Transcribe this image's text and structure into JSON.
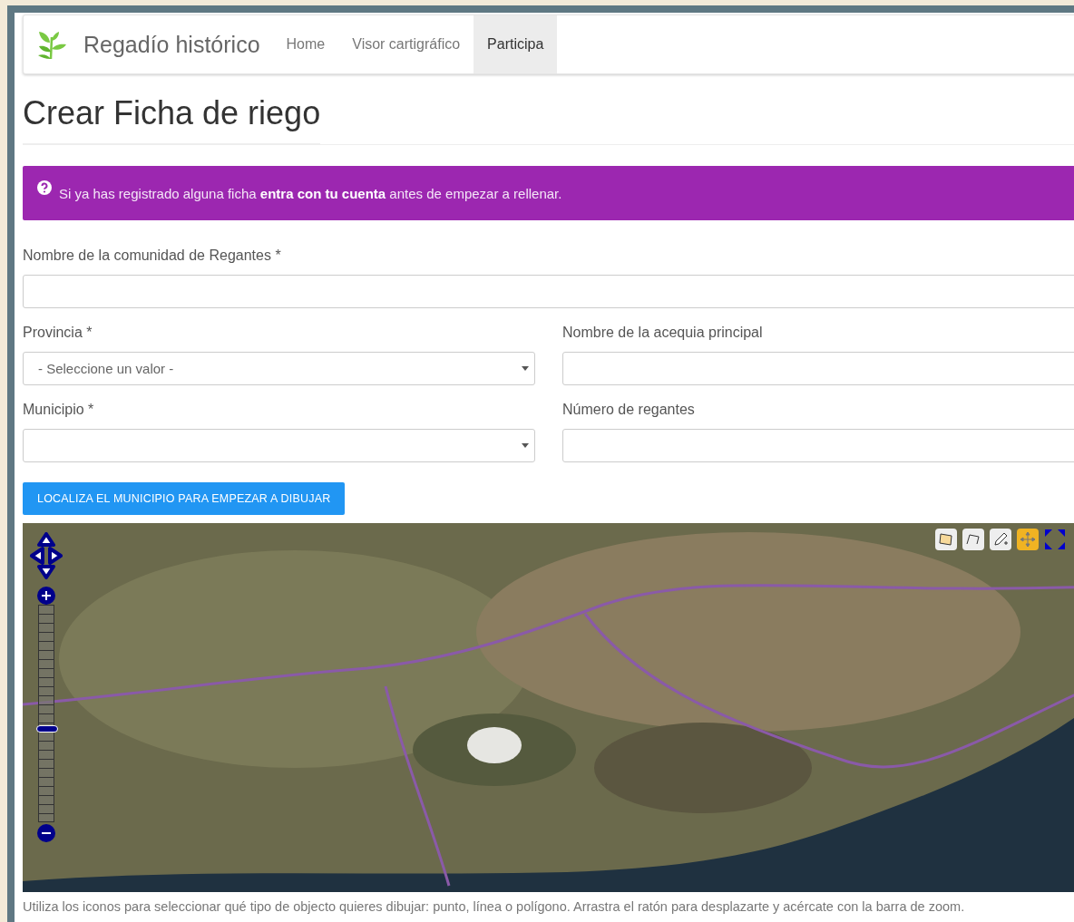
{
  "navbar": {
    "brand": "Regadío histórico",
    "items": [
      {
        "label": "Home",
        "selected": false
      },
      {
        "label": "Visor cartigráfico",
        "selected": false
      },
      {
        "label": "Participa",
        "selected": true
      }
    ]
  },
  "page_title": "Crear Ficha de riego",
  "alert": {
    "text": "Si ya has registrado alguna ficha **entra con tu cuenta** antes de empezar a rellenar."
  },
  "form": {
    "community": {
      "label": "Nombre de la comunidad de Regantes *"
    },
    "province": {
      "label": "Provincia *",
      "value": "- Seleccione un valor -"
    },
    "main_ditch": {
      "label": "Nombre de la acequia principal"
    },
    "municipality": {
      "label": "Municipio *"
    },
    "irrigators": {
      "label": "Número de regantes"
    },
    "locate_button": "LOCALIZA EL MUNICIPIO PARA EMPEZAR A DIBUJAR"
  },
  "map": {
    "zoom": {
      "level": 0.43
    },
    "tools": [
      {
        "kind": "polygon",
        "selected": false
      },
      {
        "kind": "line",
        "selected": false
      },
      {
        "kind": "point",
        "selected": false
      },
      {
        "kind": "pan",
        "selected": true
      }
    ],
    "caption": "Utiliza los iconos para seleccionar qué tipo de objecto quieres dibujar: punto, línea o polígono. Arrastra el ratón para desplazarte y acércate con la barra de zoom."
  }
}
